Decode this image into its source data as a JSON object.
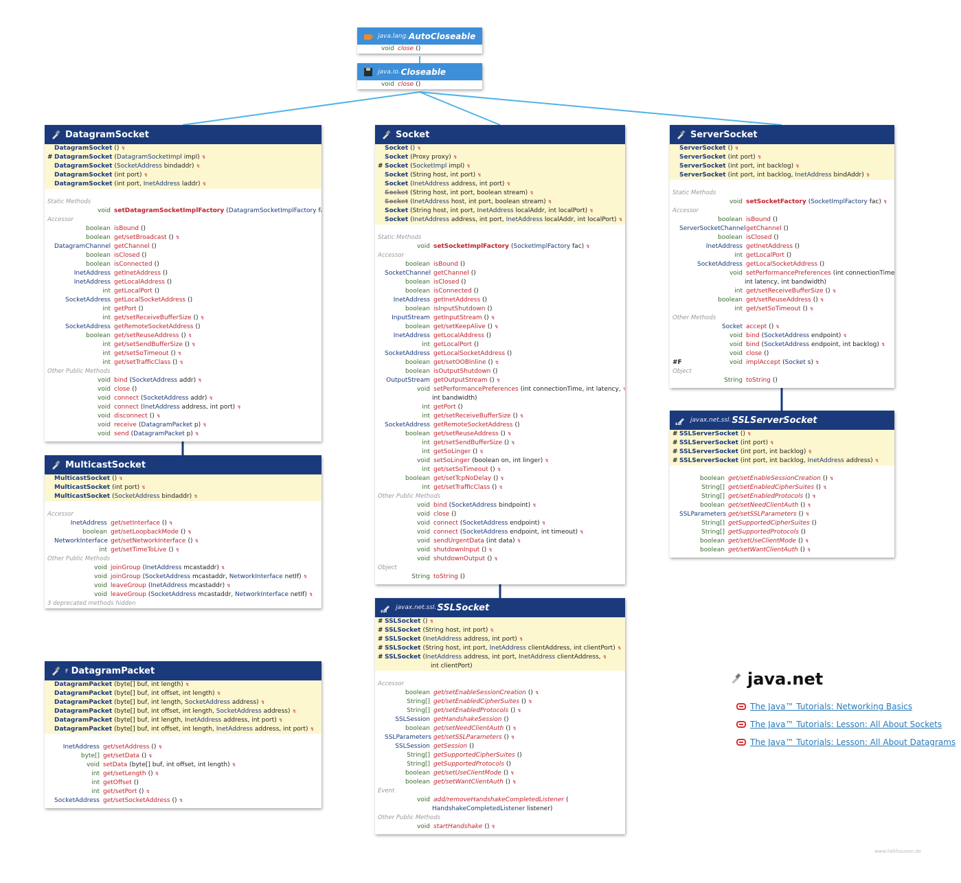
{
  "package": {
    "name": "java.net",
    "credit": "www.falkhausen.de"
  },
  "links": [
    "The Java™ Tutorials: Networking Basics",
    "The Java™ Tutorials: Lesson: All About Sockets",
    "The Java™ Tutorials: Lesson: All About Datagrams"
  ],
  "autocloseable": {
    "pkg": "java.lang.",
    "name": "AutoCloseable",
    "rows": [
      [
        "void",
        "close",
        "()"
      ]
    ]
  },
  "closeable": {
    "pkg": "java.io.",
    "name": "Closeable",
    "rows": [
      [
        "void",
        "close",
        "()"
      ]
    ]
  },
  "sections": {
    "static": "Static Methods",
    "accessor": "Accessor",
    "other": "Other Public Methods",
    "otherm": "Other Methods",
    "object": "Object",
    "event": "Event"
  },
  "datagramsocket": {
    "name": "DatagramSocket",
    "ctors": [
      [
        "",
        "DatagramSocket",
        "()"
      ],
      [
        "#",
        "DatagramSocket",
        "(DatagramSocketImpl impl)"
      ],
      [
        "",
        "DatagramSocket",
        "(SocketAddress bindaddr)"
      ],
      [
        "",
        "DatagramSocket",
        "(int port)"
      ],
      [
        "",
        "DatagramSocket",
        "(int port, InetAddress laddr)"
      ]
    ],
    "static": [
      [
        "void",
        "setDatagramSocketImplFactory",
        "(DatagramSocketImplFactory fac)"
      ]
    ],
    "accessor": [
      [
        "boolean",
        "isBound",
        "()"
      ],
      [
        "boolean",
        "get/setBroadcast",
        "()"
      ],
      [
        "DatagramChannel",
        "getChannel",
        "()"
      ],
      [
        "boolean",
        "isClosed",
        "()"
      ],
      [
        "boolean",
        "isConnected",
        "()"
      ],
      [
        "InetAddress",
        "getInetAddress",
        "()"
      ],
      [
        "InetAddress",
        "getLocalAddress",
        "()"
      ],
      [
        "int",
        "getLocalPort",
        "()"
      ],
      [
        "SocketAddress",
        "getLocalSocketAddress",
        "()"
      ],
      [
        "int",
        "getPort",
        "()"
      ],
      [
        "int",
        "get/setReceiveBufferSize",
        "()"
      ],
      [
        "SocketAddress",
        "getRemoteSocketAddress",
        "()"
      ],
      [
        "boolean",
        "get/setReuseAddress",
        "()"
      ],
      [
        "int",
        "get/setSendBufferSize",
        "()"
      ],
      [
        "int",
        "get/setSoTimeout",
        "()"
      ],
      [
        "int",
        "get/setTrafficClass",
        "()"
      ]
    ],
    "other": [
      [
        "void",
        "bind",
        "(SocketAddress addr)"
      ],
      [
        "void",
        "close",
        "()"
      ],
      [
        "void",
        "connect",
        "(SocketAddress addr)"
      ],
      [
        "void",
        "connect",
        "(InetAddress address, int port)"
      ],
      [
        "void",
        "disconnect",
        "()"
      ],
      [
        "void",
        "receive",
        "(DatagramPacket p)"
      ],
      [
        "void",
        "send",
        "(DatagramPacket p)"
      ]
    ]
  },
  "multicastsocket": {
    "name": "MulticastSocket",
    "ctors": [
      [
        "",
        "MulticastSocket",
        "()"
      ],
      [
        "",
        "MulticastSocket",
        "(int port)"
      ],
      [
        "",
        "MulticastSocket",
        "(SocketAddress bindaddr)"
      ]
    ],
    "accessor": [
      [
        "InetAddress",
        "get/setInterface",
        "()"
      ],
      [
        "boolean",
        "get/setLoopbackMode",
        "()"
      ],
      [
        "NetworkInterface",
        "get/setNetworkInterface",
        "()"
      ],
      [
        "int",
        "get/setTimeToLive",
        "()"
      ]
    ],
    "other": [
      [
        "void",
        "joinGroup",
        "(InetAddress mcastaddr)"
      ],
      [
        "void",
        "joinGroup",
        "(SocketAddress mcastaddr, NetworkInterface netIf)"
      ],
      [
        "void",
        "leaveGroup",
        "(InetAddress mcastaddr)"
      ],
      [
        "void",
        "leaveGroup",
        "(SocketAddress mcastaddr, NetworkInterface netIf)"
      ]
    ],
    "footer": "3 deprecated methods hidden"
  },
  "datagrampacket": {
    "mod": "F",
    "name": "DatagramPacket",
    "ctors": [
      [
        "",
        "DatagramPacket",
        "(byte[] buf, int length)"
      ],
      [
        "",
        "DatagramPacket",
        "(byte[] buf, int offset, int length)"
      ],
      [
        "",
        "DatagramPacket",
        "(byte[] buf, int length, SocketAddress address)"
      ],
      [
        "",
        "DatagramPacket",
        "(byte[] buf, int offset, int length, SocketAddress address)"
      ],
      [
        "",
        "DatagramPacket",
        "(byte[] buf, int length, InetAddress address, int port)"
      ],
      [
        "",
        "DatagramPacket",
        "(byte[] buf, int offset, int length, InetAddress address, int port)"
      ]
    ],
    "accessor": [
      [
        "InetAddress",
        "get/setAddress",
        "()"
      ],
      [
        "byte[]",
        "get/setData",
        "()"
      ],
      [
        "void",
        "setData",
        "(byte[] buf, int offset, int length)"
      ],
      [
        "int",
        "get/setLength",
        "()"
      ],
      [
        "int",
        "getOffset",
        "()"
      ],
      [
        "int",
        "get/setPort",
        "()"
      ],
      [
        "SocketAddress",
        "get/setSocketAddress",
        "()"
      ]
    ]
  },
  "socket": {
    "name": "Socket",
    "ctors": [
      [
        "",
        "Socket",
        "()"
      ],
      [
        "",
        "Socket",
        "(Proxy proxy)"
      ],
      [
        "#",
        "Socket",
        "(SocketImpl impl)"
      ],
      [
        "",
        "Socket",
        "(String host, int port)"
      ],
      [
        "",
        "Socket",
        "(InetAddress address, int port)"
      ],
      [
        "",
        "Socket",
        "(String host, int port, boolean stream)"
      ],
      [
        "",
        "Socket",
        "(InetAddress host, int port, boolean stream)"
      ],
      [
        "",
        "Socket",
        "(String host, int port, InetAddress localAddr, int localPort)"
      ],
      [
        "",
        "Socket",
        "(InetAddress address, int port, InetAddress localAddr, int localPort)"
      ]
    ],
    "static": [
      [
        "void",
        "setSocketImplFactory",
        "(SocketImplFactory fac)"
      ]
    ],
    "accessor": [
      [
        "boolean",
        "isBound",
        "()"
      ],
      [
        "SocketChannel",
        "getChannel",
        "()"
      ],
      [
        "boolean",
        "isClosed",
        "()"
      ],
      [
        "boolean",
        "isConnected",
        "()"
      ],
      [
        "InetAddress",
        "getInetAddress",
        "()"
      ],
      [
        "boolean",
        "isInputShutdown",
        "()"
      ],
      [
        "InputStream",
        "getInputStream",
        "()"
      ],
      [
        "boolean",
        "get/setKeepAlive",
        "()"
      ],
      [
        "InetAddress",
        "getLocalAddress",
        "()"
      ],
      [
        "int",
        "getLocalPort",
        "()"
      ],
      [
        "SocketAddress",
        "getLocalSocketAddress",
        "()"
      ],
      [
        "boolean",
        "get/setOOBInline",
        "()"
      ],
      [
        "boolean",
        "isOutputShutdown",
        "()"
      ],
      [
        "OutputStream",
        "getOutputStream",
        "()"
      ],
      [
        "void",
        "setPerformancePreferences",
        "(int connectionTime, int latency,"
      ],
      [
        "",
        "",
        "int bandwidth)"
      ],
      [
        "int",
        "getPort",
        "()"
      ],
      [
        "int",
        "get/setReceiveBufferSize",
        "()"
      ],
      [
        "SocketAddress",
        "getRemoteSocketAddress",
        "()"
      ],
      [
        "boolean",
        "get/setReuseAddress",
        "()"
      ],
      [
        "int",
        "get/setSendBufferSize",
        "()"
      ],
      [
        "int",
        "getSoLinger",
        "()"
      ],
      [
        "void",
        "setSoLinger",
        "(boolean on, int linger)"
      ],
      [
        "int",
        "get/setSoTimeout",
        "()"
      ],
      [
        "boolean",
        "get/setTcpNoDelay",
        "()"
      ],
      [
        "int",
        "get/setTrafficClass",
        "()"
      ]
    ],
    "other": [
      [
        "void",
        "bind",
        "(SocketAddress bindpoint)"
      ],
      [
        "void",
        "close",
        "()"
      ],
      [
        "void",
        "connect",
        "(SocketAddress endpoint)"
      ],
      [
        "void",
        "connect",
        "(SocketAddress endpoint, int timeout)"
      ],
      [
        "void",
        "sendUrgentData",
        "(int data)"
      ],
      [
        "void",
        "shutdownInput",
        "()"
      ],
      [
        "void",
        "shutdownOutput",
        "()"
      ]
    ],
    "object": [
      [
        "String",
        "toString",
        "()"
      ]
    ]
  },
  "sslsocket": {
    "pkg": "javax.net.ssl.",
    "name": "SSLSocket",
    "ctors": [
      [
        "#",
        "SSLSocket",
        "()"
      ],
      [
        "#",
        "SSLSocket",
        "(String host, int port)"
      ],
      [
        "#",
        "SSLSocket",
        "(InetAddress address, int port)"
      ],
      [
        "#",
        "SSLSocket",
        "(String host, int port, InetAddress clientAddress, int clientPort)"
      ],
      [
        "#",
        "SSLSocket",
        "(InetAddress address, int port, InetAddress clientAddress,"
      ],
      [
        "",
        "",
        "int clientPort)"
      ]
    ],
    "accessor": [
      [
        "boolean",
        "get/setEnableSessionCreation",
        "()"
      ],
      [
        "String[]",
        "get/setEnabledCipherSuites",
        "()"
      ],
      [
        "String[]",
        "get/setEnabledProtocols",
        "()"
      ],
      [
        "SSLSession",
        "getHandshakeSession",
        "()"
      ],
      [
        "boolean",
        "get/setNeedClientAuth",
        "()"
      ],
      [
        "SSLParameters",
        "get/setSSLParameters",
        "()"
      ],
      [
        "SSLSession",
        "getSession",
        "()"
      ],
      [
        "String[]",
        "getSupportedCipherSuites",
        "()"
      ],
      [
        "String[]",
        "getSupportedProtocols",
        "()"
      ],
      [
        "boolean",
        "get/setUseClientMode",
        "()"
      ],
      [
        "boolean",
        "get/setWantClientAuth",
        "()"
      ]
    ],
    "event": [
      [
        "void",
        "add/removeHandshakeCompletedListener",
        "("
      ],
      [
        "",
        "",
        "HandshakeCompletedListener listener)"
      ]
    ],
    "other": [
      [
        "void",
        "startHandshake",
        "()"
      ]
    ]
  },
  "serversocket": {
    "name": "ServerSocket",
    "ctors": [
      [
        "",
        "ServerSocket",
        "()"
      ],
      [
        "",
        "ServerSocket",
        "(int port)"
      ],
      [
        "",
        "ServerSocket",
        "(int port, int backlog)"
      ],
      [
        "",
        "ServerSocket",
        "(int port, int backlog, InetAddress bindAddr)"
      ]
    ],
    "static": [
      [
        "void",
        "setSocketFactory",
        "(SocketImplFactory fac)"
      ]
    ],
    "accessor": [
      [
        "boolean",
        "isBound",
        "()"
      ],
      [
        "ServerSocketChannel",
        "getChannel",
        "()"
      ],
      [
        "boolean",
        "isClosed",
        "()"
      ],
      [
        "InetAddress",
        "getInetAddress",
        "()"
      ],
      [
        "int",
        "getLocalPort",
        "()"
      ],
      [
        "SocketAddress",
        "getLocalSocketAddress",
        "()"
      ],
      [
        "void",
        "setPerformancePreferences",
        "(int connectionTime,"
      ],
      [
        "",
        "",
        "int latency, int bandwidth)"
      ],
      [
        "int",
        "get/setReceiveBufferSize",
        "()"
      ],
      [
        "boolean",
        "get/setReuseAddress",
        "()"
      ],
      [
        "int",
        "get/setSoTimeout",
        "()"
      ]
    ],
    "other": [
      [
        "Socket",
        "accept",
        "()"
      ],
      [
        "void",
        "bind",
        "(SocketAddress endpoint)"
      ],
      [
        "void",
        "bind",
        "(SocketAddress endpoint, int backlog)"
      ],
      [
        "void",
        "close",
        "()"
      ],
      [
        "void",
        "implAccept",
        "(Socket s)"
      ]
    ],
    "object": [
      [
        "String",
        "toString",
        "()"
      ]
    ]
  },
  "sslserversocket": {
    "pkg": "javax.net.ssl.",
    "name": "SSLServerSocket",
    "ctors": [
      [
        "#",
        "SSLServerSocket",
        "()"
      ],
      [
        "#",
        "SSLServerSocket",
        "(int port)"
      ],
      [
        "#",
        "SSLServerSocket",
        "(int port, int backlog)"
      ],
      [
        "#",
        "SSLServerSocket",
        "(int port, int backlog, InetAddress address)"
      ]
    ],
    "accessor": [
      [
        "boolean",
        "get/setEnableSessionCreation",
        "()"
      ],
      [
        "String[]",
        "get/setEnabledCipherSuites",
        "()"
      ],
      [
        "String[]",
        "get/setEnabledProtocols",
        "()"
      ],
      [
        "boolean",
        "get/setNeedClientAuth",
        "()"
      ],
      [
        "SSLParameters",
        "get/setSSLParameters",
        "()"
      ],
      [
        "String[]",
        "getSupportedCipherSuites",
        "()"
      ],
      [
        "String[]",
        "getSupportedProtocols",
        "()"
      ],
      [
        "boolean",
        "get/setUseClientMode",
        "()"
      ],
      [
        "boolean",
        "get/setWantClientAuth",
        "()"
      ]
    ]
  }
}
